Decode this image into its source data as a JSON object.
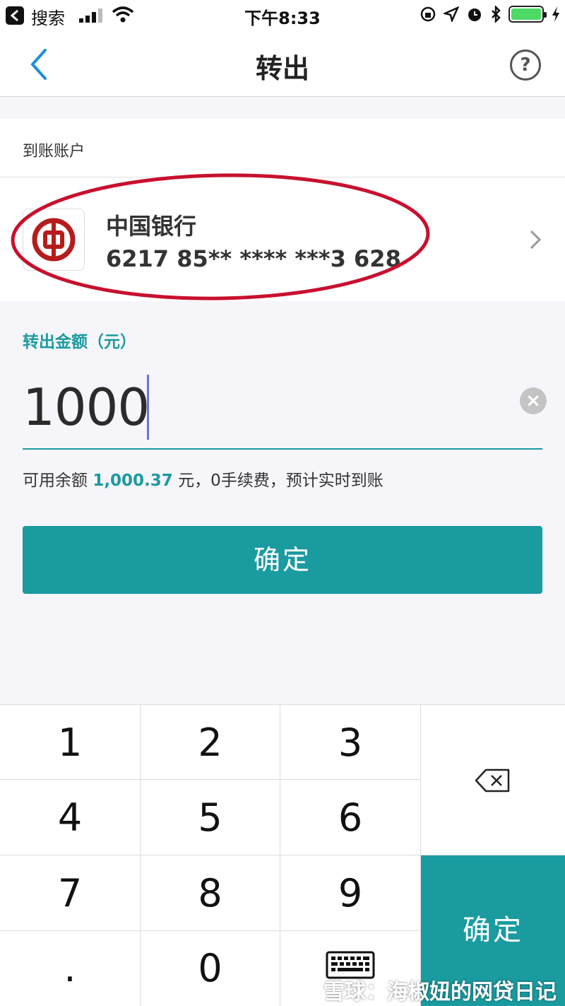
{
  "status_bar": {
    "back_app_label": "搜索",
    "time": "下午8:33"
  },
  "nav": {
    "title": "转出",
    "help_glyph": "?"
  },
  "account": {
    "section_label": "到账账户",
    "bank_name": "中国银行",
    "card_number": "6217 85** **** ***3 628"
  },
  "amount": {
    "label": "转出金额（元）",
    "value": "1000",
    "clear_glyph": "×"
  },
  "balance": {
    "prefix": "可用余额",
    "amount": "1,000.37",
    "suffix": "元，0手续费，预计实时到账"
  },
  "confirm_button": "确定",
  "keypad": {
    "keys": [
      "1",
      "2",
      "3",
      "4",
      "5",
      "6",
      "7",
      "8",
      "9",
      ".",
      "0"
    ],
    "confirm_label": "确定",
    "icons": {
      "backspace": "backspace-icon",
      "hide_keyboard": "keyboard-icon"
    }
  },
  "watermark": "雪球：海椒妞的网贷日记",
  "colors": {
    "accent": "#1a9ba0",
    "annotation": "#c8102e"
  }
}
